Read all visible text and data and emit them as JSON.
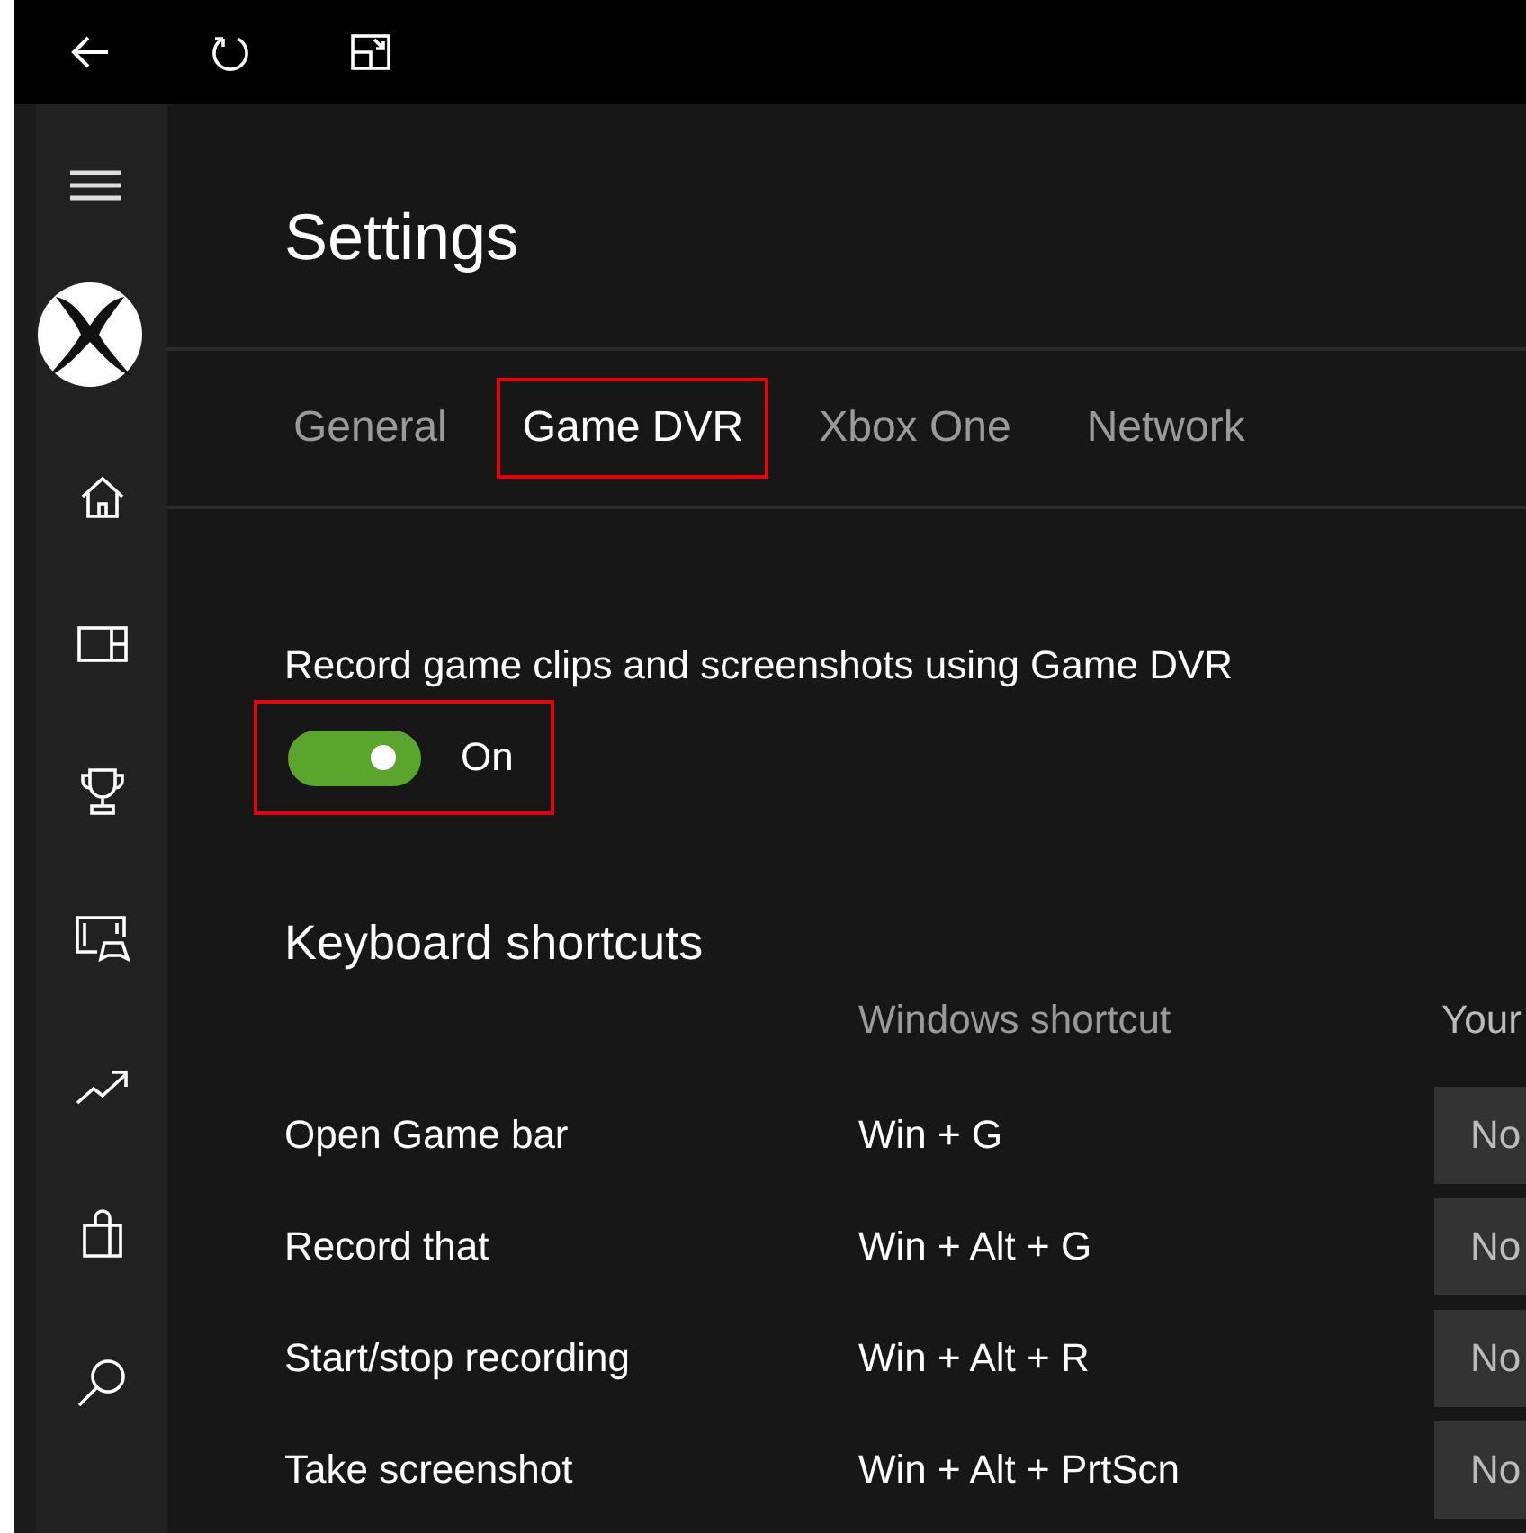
{
  "toolbar": {
    "buttons": [
      {
        "kind": "back"
      },
      {
        "kind": "refresh"
      },
      {
        "kind": "snap"
      }
    ]
  },
  "sidebar": {
    "items": [
      {
        "kind": "menu"
      },
      {
        "kind": "logo"
      },
      {
        "kind": "home"
      },
      {
        "kind": "panels"
      },
      {
        "kind": "trophy"
      },
      {
        "kind": "dvr"
      },
      {
        "kind": "trending"
      },
      {
        "kind": "store"
      },
      {
        "kind": "search"
      }
    ]
  },
  "title": "Settings",
  "tabs": [
    {
      "label": "General",
      "selected": false,
      "highlighted": false
    },
    {
      "label": "Game DVR",
      "selected": true,
      "highlighted": true
    },
    {
      "label": "Xbox One",
      "selected": false,
      "highlighted": false
    },
    {
      "label": "Network",
      "selected": false,
      "highlighted": false
    }
  ],
  "record_setting": {
    "label": "Record game clips and screenshots using Game DVR",
    "on": true,
    "state_text": "On",
    "highlighted": true
  },
  "shortcuts": {
    "heading": "Keyboard shortcuts",
    "columns": [
      "Windows shortcut",
      "Your"
    ],
    "rows": [
      {
        "action": "Open Game bar",
        "windows_shortcut": "Win + G",
        "your_shortcut": "No"
      },
      {
        "action": "Record that",
        "windows_shortcut": "Win + Alt + G",
        "your_shortcut": "No"
      },
      {
        "action": "Start/stop recording",
        "windows_shortcut": "Win + Alt + R",
        "your_shortcut": "No"
      },
      {
        "action": "Take screenshot",
        "windows_shortcut": "Win + Alt + PrtScn",
        "your_shortcut": "No"
      }
    ]
  }
}
